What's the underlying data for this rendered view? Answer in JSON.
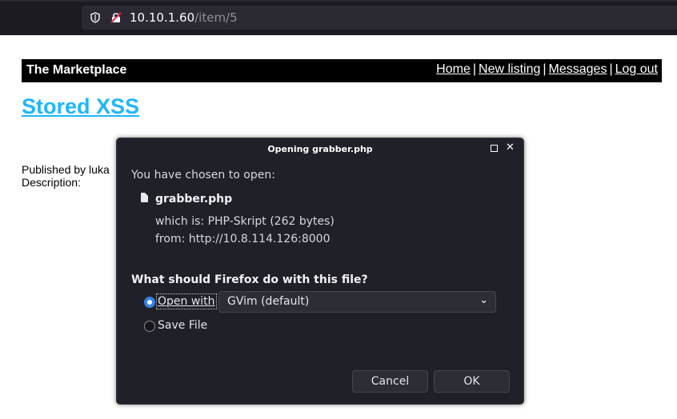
{
  "browser": {
    "url_host": "10.10.1.60",
    "url_path": "/item/5"
  },
  "page": {
    "brand": "The Marketplace",
    "nav": [
      "Home",
      "New listing",
      "Messages",
      "Log out"
    ],
    "nav_separator": "|",
    "title": "Stored XSS",
    "published_by": "Published by luka",
    "description_label": "Description:"
  },
  "dialog": {
    "title": "Opening grabber.php",
    "intro": "You have chosen to open:",
    "filename": "grabber.php",
    "which_is": "which is:  PHP-Skript (262 bytes)",
    "from": "from:  http://10.8.114.126:8000",
    "question": "What should Firefox do with this file?",
    "open_with_label": "Open with",
    "open_with_value": "GVim (default)",
    "save_file_label": "Save File",
    "cancel_label": "Cancel",
    "ok_label": "OK",
    "selected_option": "open_with"
  }
}
